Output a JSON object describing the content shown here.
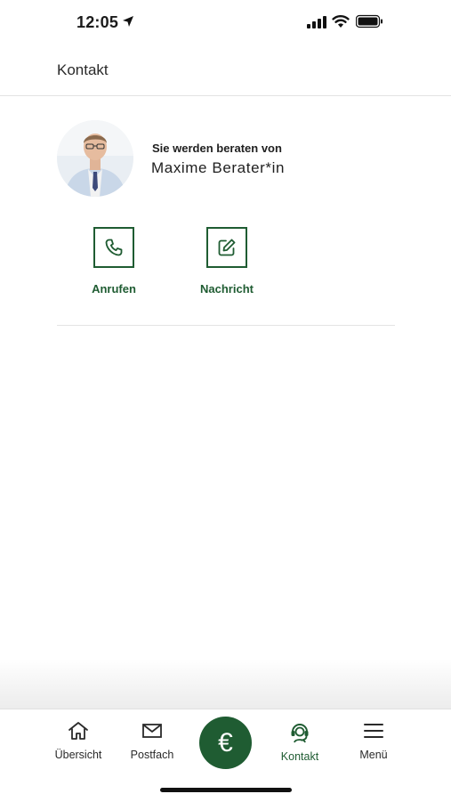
{
  "status_bar": {
    "time": "12:05"
  },
  "header": {
    "title": "Kontakt"
  },
  "advisor": {
    "label": "Sie werden beraten von",
    "name": "Maxime Berater*in"
  },
  "actions": [
    {
      "label": "Anrufen",
      "icon": "phone-icon"
    },
    {
      "label": "Nachricht",
      "icon": "edit-icon"
    }
  ],
  "tabbar": {
    "items": [
      {
        "label": "Übersicht",
        "icon": "home-icon"
      },
      {
        "label": "Postfach",
        "icon": "mail-icon"
      },
      {
        "label": "",
        "icon": "euro-icon",
        "glyph": "€"
      },
      {
        "label": "Kontakt",
        "icon": "headset-icon",
        "active": true
      },
      {
        "label": "Menü",
        "icon": "menu-icon"
      }
    ]
  },
  "colors": {
    "accent": "#1f5c32",
    "text": "#1b1b1b",
    "divider": "#e3e3e3"
  }
}
